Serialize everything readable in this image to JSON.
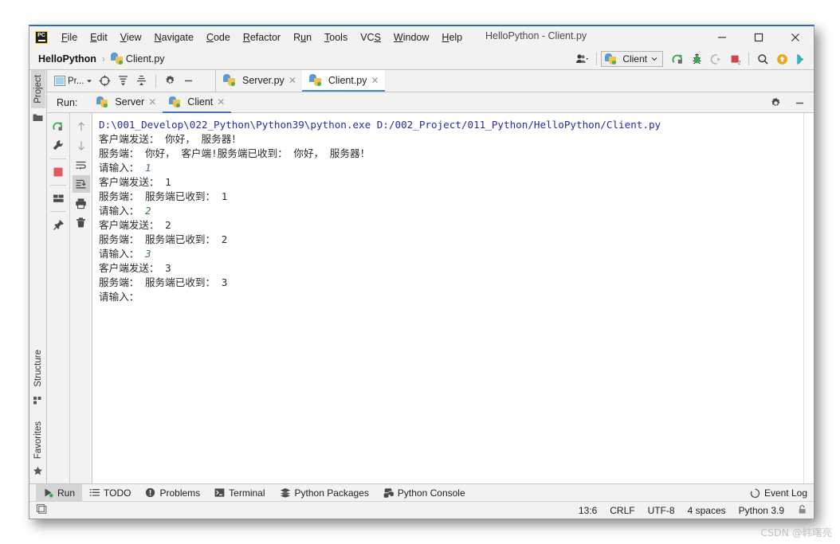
{
  "window": {
    "title": "HelloPython - Client.py",
    "app_icon": "pycharm-logo-icon",
    "minimize": "minimize-icon",
    "maximize": "maximize-icon",
    "close": "close-icon"
  },
  "menubar": {
    "items": [
      {
        "label": "File",
        "mnemonic": "F"
      },
      {
        "label": "Edit",
        "mnemonic": "E"
      },
      {
        "label": "View",
        "mnemonic": "V"
      },
      {
        "label": "Navigate",
        "mnemonic": "N"
      },
      {
        "label": "Code",
        "mnemonic": "C"
      },
      {
        "label": "Refactor",
        "mnemonic": "R"
      },
      {
        "label": "Run",
        "mnemonic": "u"
      },
      {
        "label": "Tools",
        "mnemonic": "T"
      },
      {
        "label": "VCS",
        "mnemonic": "S"
      },
      {
        "label": "Window",
        "mnemonic": "W"
      },
      {
        "label": "Help",
        "mnemonic": "H"
      }
    ]
  },
  "navbar": {
    "project": "HelloPython",
    "separator": "›",
    "file": "Client.py",
    "run_config": "Client",
    "icons": [
      "user-avatar-icon",
      "rerun-icon",
      "debug-icon",
      "run-with-coverage-icon",
      "stop-icon",
      "search-everywhere-icon",
      "update-project-icon",
      "run-icon"
    ]
  },
  "left_strip": {
    "top": {
      "label": "Project",
      "icon": "folder-icon"
    },
    "bottom": [
      {
        "label": "Structure",
        "icon": "structure-icon"
      },
      {
        "label": "Favorites",
        "icon": "star-icon"
      }
    ]
  },
  "project_toolbar": {
    "dropdown_label": "Pr...",
    "icons": [
      "locate-icon",
      "expand-all-icon",
      "collapse-all-icon",
      "settings-gear-icon",
      "hide-icon"
    ]
  },
  "editor_tabs": [
    {
      "label": "Server.py",
      "active": false,
      "close": "close-tab-icon"
    },
    {
      "label": "Client.py",
      "active": true,
      "close": "close-tab-icon"
    }
  ],
  "run_tool": {
    "label": "Run:",
    "tabs": [
      {
        "label": "Server",
        "active": false,
        "close": "close-tab-icon"
      },
      {
        "label": "Client",
        "active": true,
        "close": "close-tab-icon"
      }
    ],
    "header_icons": [
      "settings-gear-icon",
      "hide-icon"
    ],
    "gutter_left": [
      "rerun-icon",
      "wrench-icon",
      "stop-icon",
      "layout-icon",
      "pin-icon"
    ],
    "gutter_right": [
      "up-arrow-icon",
      "down-arrow-icon",
      "soft-wrap-icon",
      "scroll-to-end-icon",
      "print-icon",
      "trash-icon"
    ]
  },
  "console": {
    "lines": [
      {
        "type": "cmd",
        "text": "D:\\001_Develop\\022_Python\\Python39\\python.exe D:/002_Project/011_Python/HelloPython/Client.py"
      },
      {
        "type": "out",
        "text": "客户端发送： 你好， 服务器！"
      },
      {
        "type": "out",
        "text": "服务端： 你好， 客户端!服务端已收到： 你好， 服务器！"
      },
      {
        "type": "prompt",
        "text": "请输入：",
        "input": "1"
      },
      {
        "type": "out",
        "text": "客户端发送： 1"
      },
      {
        "type": "out",
        "text": "服务端： 服务端已收到： 1"
      },
      {
        "type": "prompt",
        "text": "请输入：",
        "input": "2"
      },
      {
        "type": "out",
        "text": "客户端发送： 2"
      },
      {
        "type": "out",
        "text": "服务端： 服务端已收到： 2"
      },
      {
        "type": "prompt",
        "text": "请输入：",
        "input": "3"
      },
      {
        "type": "out",
        "text": "客户端发送： 3"
      },
      {
        "type": "out",
        "text": "服务端： 服务端已收到： 3"
      },
      {
        "type": "prompt",
        "text": "请输入：",
        "input": ""
      }
    ]
  },
  "bottom_tabs": [
    {
      "label": "Run",
      "icon": "run-icon",
      "active": true
    },
    {
      "label": "TODO",
      "icon": "todo-icon",
      "active": false
    },
    {
      "label": "Problems",
      "icon": "problems-icon",
      "active": false
    },
    {
      "label": "Terminal",
      "icon": "terminal-icon",
      "active": false
    },
    {
      "label": "Python Packages",
      "icon": "packages-icon",
      "active": false
    },
    {
      "label": "Python Console",
      "icon": "python-console-icon",
      "active": false
    }
  ],
  "event_log": {
    "label": "Event Log",
    "icon": "event-log-icon"
  },
  "statusbar": {
    "caret": "13:6",
    "line_sep": "CRLF",
    "encoding": "UTF-8",
    "indent": "4 spaces",
    "interpreter": "Python 3.9",
    "lock": "lock-icon",
    "hide_window_icon": "hide-toolwindow-icon"
  },
  "watermark": "CSDN @韩曙亮",
  "colors": {
    "accent": "#3c78b4",
    "chrome": "#f2f2f2",
    "console_cmd": "#2a2aa8",
    "console_input": "#3b7a3b",
    "title_border": "#2d6ebc"
  }
}
